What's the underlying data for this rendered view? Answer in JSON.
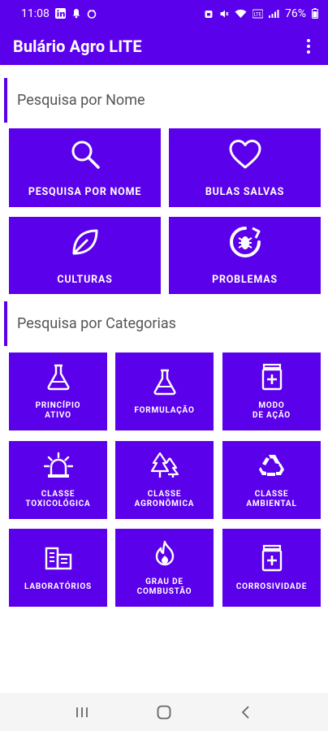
{
  "status_bar": {
    "time": "11:08",
    "left_icons": [
      "linkedin-icon",
      "notification-icon",
      "notification-icon-2"
    ],
    "battery_percent": "76%"
  },
  "app_bar": {
    "title": "Bulário Agro LITE",
    "menu_icon": "more-vert-icon"
  },
  "sections": {
    "by_name": {
      "header": "Pesquisa por Nome",
      "tiles": [
        {
          "label": "PESQUISA POR NOME",
          "icon": "search-icon"
        },
        {
          "label": "BULAS SALVAS",
          "icon": "heart-icon"
        },
        {
          "label": "CULTURAS",
          "icon": "leaf-icon"
        },
        {
          "label": "PROBLEMAS",
          "icon": "pest-icon"
        }
      ]
    },
    "by_category": {
      "header": "Pesquisa por Categorias",
      "tiles": [
        {
          "label": "PRINCÍPIO\nATIVO",
          "icon": "flask-icon"
        },
        {
          "label": "FORMULAÇÃO",
          "icon": "flask-icon"
        },
        {
          "label": "MODO\nDE AÇÃO",
          "icon": "medicine-icon"
        },
        {
          "label": "CLASSE\nTOXICOLÓGICA",
          "icon": "alarm-light-icon"
        },
        {
          "label": "CLASSE\nAGRONÔMICA",
          "icon": "trees-icon"
        },
        {
          "label": "CLASSE\nAMBIENTAL",
          "icon": "recycle-icon"
        },
        {
          "label": "LABORATÓRIOS",
          "icon": "building-icon"
        },
        {
          "label": "GRAU DE\nCOMBUSTÃO",
          "icon": "fire-icon"
        },
        {
          "label": "CORROSIVIDADE",
          "icon": "medicine-icon"
        }
      ]
    }
  },
  "nav_bar": {
    "recents_icon": "recents-icon",
    "home_icon": "home-icon",
    "back_icon": "back-icon"
  },
  "colors": {
    "primary": "#5b00ea",
    "header_text": "#555555",
    "nav_bar": "#f5f5f5"
  }
}
